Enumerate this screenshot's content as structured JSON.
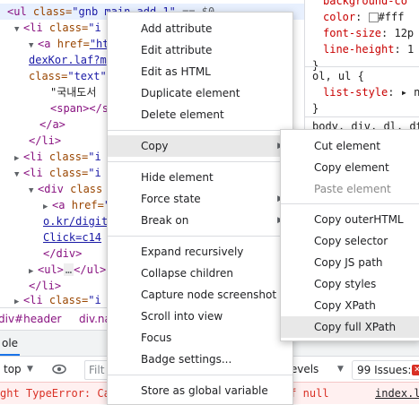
{
  "elements_panel": {
    "lines": [
      {
        "html_tag": "<ul ",
        "attr": "class=",
        "val": "\"gnb main add 1\"",
        "tail": " == $0"
      },
      {
        "t1": "<li ",
        "a1": "class=",
        "v1": "\"i"
      },
      {
        "t1": "<a ",
        "a1": "href=",
        "v1": "\"ht"
      },
      {
        "t1": "dexKor.laf?m"
      },
      {
        "a1": "class=",
        "v1": "\"text\""
      },
      {
        "t1": "\"국내도서"
      },
      {
        "t1": "<span></s"
      },
      {
        "t1": "</a>"
      },
      {
        "t1": "</li>"
      },
      {
        "t1": "<li ",
        "a1": "class=",
        "v1": "\"i"
      },
      {
        "t1": "<li ",
        "a1": "class=",
        "v1": "\"i"
      },
      {
        "t1": "<div ",
        "a1": "class"
      },
      {
        "t1": "<a ",
        "a1": "href=",
        "v1": "\""
      },
      {
        "t1": "o.kr/digit"
      },
      {
        "t1": "Click=c14"
      },
      {
        "t1": "</div>"
      },
      {
        "t1": "<ul>",
        "mid": "…",
        "t2": "</ul>"
      },
      {
        "t1": "</li>"
      },
      {
        "t1": "<li ",
        "a1": "class=",
        "v1": "\"i"
      }
    ]
  },
  "styles_panel": {
    "lines": [
      {
        "prop": "background-co",
        "val": ""
      },
      {
        "prop": "color",
        "val": "#fff"
      },
      {
        "prop": "font-size",
        "val": "12p"
      },
      {
        "prop": "line-height",
        "val": "1"
      },
      {
        "plain": "}"
      },
      {
        "plain": "ol, ul {"
      },
      {
        "prop": "list-style",
        "val": "n"
      },
      {
        "plain": "}"
      },
      {
        "plain": "body, div, dl, dt"
      }
    ]
  },
  "breadcrumbs": {
    "items": [
      "div#header",
      "div.navi"
    ]
  },
  "console_tabs": {
    "console": "ole"
  },
  "console_toolbar": {
    "context": "top",
    "filter_placeholder": "Filt",
    "levels": "t levels",
    "issues": "99 Issues:"
  },
  "console_error": {
    "text": "ght TypeError: Ca",
    "tail": "of null",
    "source": "index.l"
  },
  "context_menu": {
    "items": [
      {
        "label": "Add attribute"
      },
      {
        "label": "Edit attribute"
      },
      {
        "label": "Edit as HTML"
      },
      {
        "label": "Duplicate element"
      },
      {
        "label": "Delete element"
      },
      {
        "label": "Copy"
      },
      {
        "label": "Hide element"
      },
      {
        "label": "Force state"
      },
      {
        "label": "Break on"
      },
      {
        "label": "Expand recursively"
      },
      {
        "label": "Collapse children"
      },
      {
        "label": "Capture node screenshot"
      },
      {
        "label": "Scroll into view"
      },
      {
        "label": "Focus"
      },
      {
        "label": "Badge settings..."
      },
      {
        "label": "Store as global variable"
      }
    ]
  },
  "copy_submenu": {
    "items": [
      {
        "label": "Cut element"
      },
      {
        "label": "Copy element"
      },
      {
        "label": "Paste element"
      },
      {
        "label": "Copy outerHTML"
      },
      {
        "label": "Copy selector"
      },
      {
        "label": "Copy JS path"
      },
      {
        "label": "Copy styles"
      },
      {
        "label": "Copy XPath"
      },
      {
        "label": "Copy full XPath"
      }
    ]
  },
  "colors": {
    "menu_highlight": "#e8e8e8",
    "selection": "#e8f0fe",
    "error": "#d93025"
  }
}
